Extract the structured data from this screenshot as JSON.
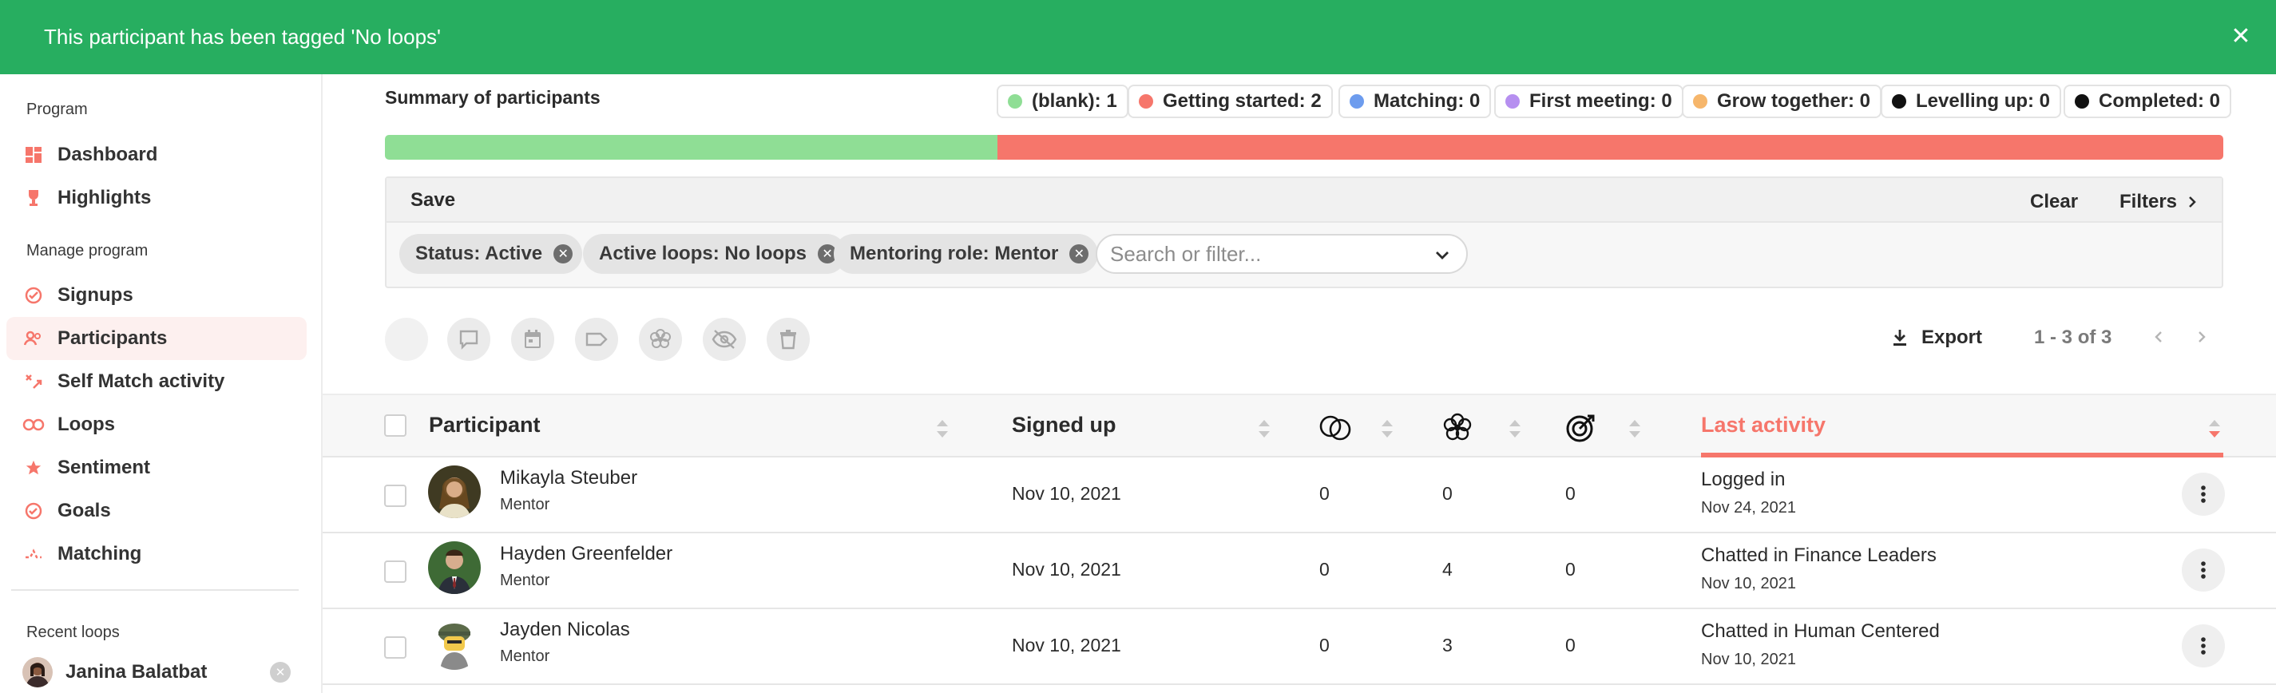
{
  "toast": {
    "message": "This participant has been tagged 'No loops'"
  },
  "sidebar": {
    "section_program": "Program",
    "section_manage": "Manage program",
    "section_recent": "Recent loops",
    "items": [
      {
        "label": "Dashboard",
        "icon": "dashboard-icon"
      },
      {
        "label": "Highlights",
        "icon": "trophy-icon"
      },
      {
        "label": "Signups",
        "icon": "signups-icon"
      },
      {
        "label": "Participants",
        "icon": "participants-icon"
      },
      {
        "label": "Self Match activity",
        "icon": "self-match-icon"
      },
      {
        "label": "Loops",
        "icon": "loops-icon"
      },
      {
        "label": "Sentiment",
        "icon": "star-icon"
      },
      {
        "label": "Goals",
        "icon": "goals-icon"
      },
      {
        "label": "Matching",
        "icon": "matching-icon"
      }
    ],
    "recent": [
      {
        "name": "Janina Balatbat"
      }
    ]
  },
  "summary": {
    "title": "Summary of participants",
    "legend": [
      {
        "label": "(blank): 1",
        "color": "#8fde95"
      },
      {
        "label": "Getting started: 2",
        "color": "#f6766b"
      },
      {
        "label": "Matching: 0",
        "color": "#6d9cee"
      },
      {
        "label": "First meeting: 0",
        "color": "#b68ff0"
      },
      {
        "label": "Grow together: 0",
        "color": "#f6b66b"
      },
      {
        "label": "Levelling up: 0",
        "color": "#111111"
      },
      {
        "label": "Completed: 0",
        "color": "#111111"
      }
    ],
    "progress": [
      {
        "fraction": 0.3333,
        "color": "#8fde95"
      },
      {
        "fraction": 0.6667,
        "color": "#f6766b"
      }
    ]
  },
  "filters": {
    "save_label": "Save",
    "clear_label": "Clear",
    "filters_label": "Filters",
    "chips": [
      {
        "label": "Status: Active"
      },
      {
        "label": "Active loops: No loops"
      },
      {
        "label": "Mentoring role: Mentor"
      }
    ],
    "search_placeholder": "Search or filter..."
  },
  "toolbar": {
    "export_label": "Export",
    "pagination": "1 - 3 of 3"
  },
  "table": {
    "headers": {
      "participant": "Participant",
      "signed_up": "Signed up",
      "last_activity": "Last activity"
    },
    "rows": [
      {
        "name": "Mikayla Steuber",
        "role": "Mentor",
        "signed_up": "Nov 10, 2021",
        "c1": "0",
        "c2": "0",
        "c3": "0",
        "activity": "Logged in",
        "activity_date": "Nov 24, 2021"
      },
      {
        "name": "Hayden Greenfelder",
        "role": "Mentor",
        "signed_up": "Nov 10, 2021",
        "c1": "0",
        "c2": "4",
        "c3": "0",
        "activity": "Chatted in Finance Leaders",
        "activity_date": "Nov 10, 2021"
      },
      {
        "name": "Jayden Nicolas",
        "role": "Mentor",
        "signed_up": "Nov 10, 2021",
        "c1": "0",
        "c2": "3",
        "c3": "0",
        "activity": "Chatted in Human Centered",
        "activity_date": "Nov 10, 2021"
      }
    ]
  },
  "colors": {
    "accent": "#f6766b",
    "toast": "#27ae60"
  }
}
